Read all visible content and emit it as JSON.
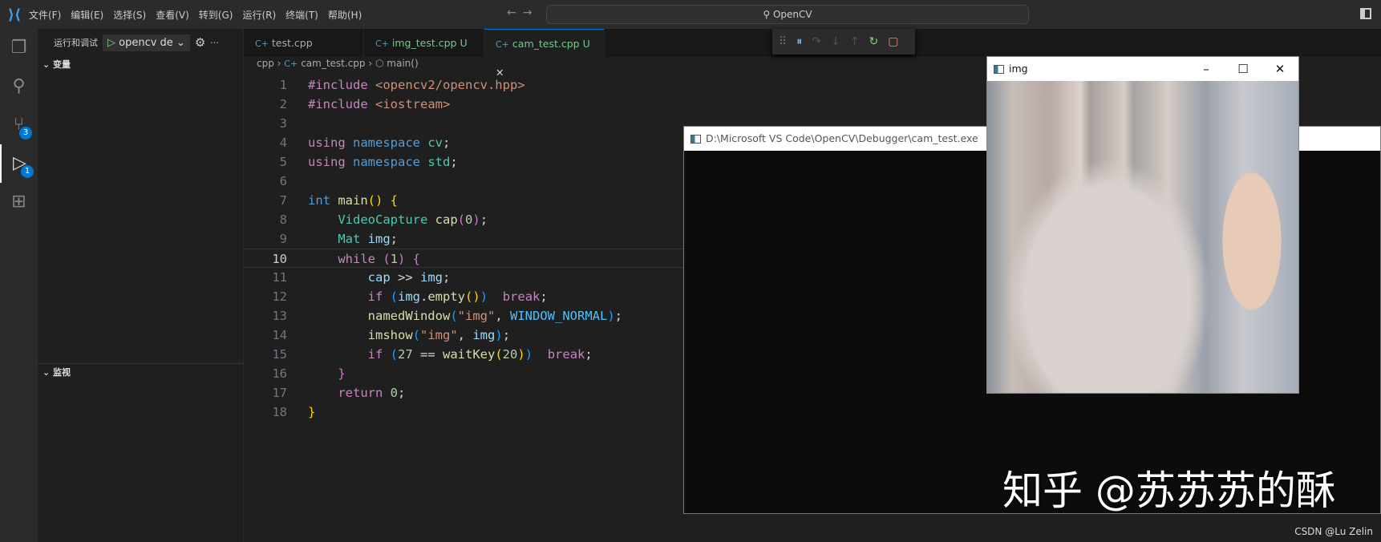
{
  "menu": [
    "文件(F)",
    "编辑(E)",
    "选择(S)",
    "查看(V)",
    "转到(G)",
    "运行(R)",
    "终端(T)",
    "帮助(H)"
  ],
  "search": "OpenCV",
  "activity": {
    "scm_badge": "3",
    "debug_badge": "1"
  },
  "side": {
    "title": "运行和调试",
    "config": "opencv de",
    "variables": "变量",
    "watch": "监视"
  },
  "tabs": [
    {
      "label": "test.cpp",
      "flag": ""
    },
    {
      "label": "img_test.cpp",
      "flag": "U"
    },
    {
      "label": "cam_test.cpp",
      "flag": "U"
    }
  ],
  "breadcrumb": [
    "cpp",
    "cam_test.cpp",
    "main()"
  ],
  "code": {
    "current_line": 10,
    "lines": [
      [
        [
          "inc",
          "#include "
        ],
        [
          "str",
          "<opencv2/opencv.hpp>"
        ]
      ],
      [
        [
          "inc",
          "#include "
        ],
        [
          "str",
          "<iostream>"
        ]
      ],
      [],
      [
        [
          "ctl",
          "using "
        ],
        [
          "kw",
          "namespace "
        ],
        [
          "ty",
          "cv"
        ],
        [
          "pl",
          ";"
        ]
      ],
      [
        [
          "ctl",
          "using "
        ],
        [
          "kw",
          "namespace "
        ],
        [
          "ty",
          "std"
        ],
        [
          "pl",
          ";"
        ]
      ],
      [],
      [
        [
          "kw",
          "int "
        ],
        [
          "fn",
          "main"
        ],
        [
          "br",
          "() {"
        ]
      ],
      [
        [
          "pl",
          "    "
        ],
        [
          "ty",
          "VideoCapture "
        ],
        [
          "fn",
          "cap"
        ],
        [
          "br2",
          "("
        ],
        [
          "num",
          "0"
        ],
        [
          "br2",
          ")"
        ],
        [
          "pl",
          ";"
        ]
      ],
      [
        [
          "pl",
          "    "
        ],
        [
          "ty",
          "Mat "
        ],
        [
          "var",
          "img"
        ],
        [
          "pl",
          ";"
        ]
      ],
      [
        [
          "pl",
          "    "
        ],
        [
          "ctl",
          "while "
        ],
        [
          "br2",
          "("
        ],
        [
          "num",
          "1"
        ],
        [
          "br2",
          ") {"
        ]
      ],
      [
        [
          "pl",
          "        "
        ],
        [
          "var",
          "cap "
        ],
        [
          "pl",
          ">> "
        ],
        [
          "var",
          "img"
        ],
        [
          "pl",
          ";"
        ]
      ],
      [
        [
          "pl",
          "        "
        ],
        [
          "ctl",
          "if "
        ],
        [
          "br3",
          "("
        ],
        [
          "var",
          "img"
        ],
        [
          "pl",
          "."
        ],
        [
          "fn",
          "empty"
        ],
        [
          "br",
          "()"
        ],
        [
          "br3",
          ")"
        ],
        [
          "pl",
          "  "
        ],
        [
          "ctl",
          "break"
        ],
        [
          "pl",
          ";"
        ]
      ],
      [
        [
          "pl",
          "        "
        ],
        [
          "fn",
          "namedWindow"
        ],
        [
          "br3",
          "("
        ],
        [
          "str",
          "\"img\""
        ],
        [
          "pl",
          ", "
        ],
        [
          "const",
          "WINDOW_NORMAL"
        ],
        [
          "br3",
          ")"
        ],
        [
          "pl",
          ";"
        ]
      ],
      [
        [
          "pl",
          "        "
        ],
        [
          "fn",
          "imshow"
        ],
        [
          "br3",
          "("
        ],
        [
          "str",
          "\"img\""
        ],
        [
          "pl",
          ", "
        ],
        [
          "var",
          "img"
        ],
        [
          "br3",
          ")"
        ],
        [
          "pl",
          ";"
        ]
      ],
      [
        [
          "pl",
          "        "
        ],
        [
          "ctl",
          "if "
        ],
        [
          "br3",
          "("
        ],
        [
          "num",
          "27 "
        ],
        [
          "pl",
          "== "
        ],
        [
          "fn",
          "waitKey"
        ],
        [
          "br",
          "("
        ],
        [
          "num",
          "20"
        ],
        [
          "br",
          ")"
        ],
        [
          "br3",
          ")"
        ],
        [
          "pl",
          "  "
        ],
        [
          "ctl",
          "break"
        ],
        [
          "pl",
          ";"
        ]
      ],
      [
        [
          "pl",
          "    "
        ],
        [
          "br2",
          "}"
        ]
      ],
      [
        [
          "pl",
          "    "
        ],
        [
          "ctl",
          "return "
        ],
        [
          "num",
          "0"
        ],
        [
          "pl",
          ";"
        ]
      ],
      [
        [
          "br",
          "}"
        ]
      ]
    ]
  },
  "console": {
    "title": "D:\\Microsoft VS Code\\OpenCV\\Debugger\\cam_test.exe"
  },
  "imgwin": {
    "title": "img"
  },
  "watermark": "知乎 @苏苏苏的酥",
  "credit": "CSDN @Lu Zelin"
}
